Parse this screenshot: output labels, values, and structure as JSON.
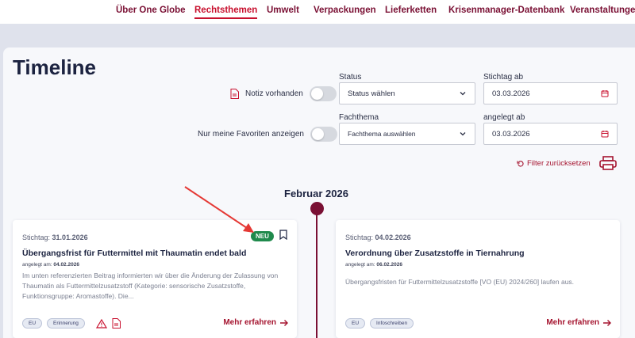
{
  "nav": {
    "items": [
      {
        "label": "Über One Globe"
      },
      {
        "label": "Rechtsthemen"
      },
      {
        "label": "Umwelt"
      },
      {
        "label": "Verpackungen"
      },
      {
        "label": "Lieferketten"
      },
      {
        "label": "Krisenmanager-Datenbank"
      },
      {
        "label": "Veranstaltungen"
      }
    ],
    "active": "Rechtsthemen"
  },
  "page": {
    "title": "Timeline"
  },
  "filters": {
    "notiz_label": "Notiz vorhanden",
    "favoriten_label": "Nur meine Favoriten anzeigen",
    "status_label": "Status",
    "status_value": "Status wählen",
    "fachthema_label": "Fachthema",
    "fachthema_value": "Fachthema auswählen",
    "stichtag_label": "Stichtag ab",
    "stichtag_value": "03.03.2026",
    "angelegt_label": "angelegt ab",
    "angelegt_value": "03.03.2026",
    "reset_label": "Filter zurücksetzen"
  },
  "timeline": {
    "month": "Februar 2026"
  },
  "cards": [
    {
      "stichtag_prefix": "Stichtag:",
      "stichtag_date": "31.01.2026",
      "title": "Übergangsfrist für Futtermittel mit Thaumatin endet bald",
      "angelegt_prefix": "angelegt am:",
      "angelegt_date": "04.02.2026",
      "desc_1": "Im unten referenzierten Beitrag informierten wir über die Änderung der Zulassung von",
      "desc_2": "Thaumatin als Futtermittelzusatzstoff (Kategorie: sensorische Zusatzstoffe,",
      "desc_3": "Funktionsgruppe: Aromastoffe). Die...",
      "badge": "NEU",
      "tags": [
        "EU",
        "Erinnerung"
      ],
      "more": "Mehr erfahren"
    },
    {
      "stichtag_prefix": "Stichtag:",
      "stichtag_date": "04.02.2026",
      "title": "Verordnung über Zusatzstoffe in Tiernahrung",
      "angelegt_prefix": "angelegt am:",
      "angelegt_date": "06.02.2026",
      "desc_1": "Übergangsfristen für Futtermittelzusatzstoffe [VO (EU) 2024/260] laufen aus.",
      "tags": [
        "EU",
        "Infoschreiben"
      ],
      "more": "Mehr erfahren"
    }
  ],
  "colors": {
    "accent": "#a5142f",
    "brand": "#7a1034",
    "neu": "#1f8a4c",
    "annotation": "#e53935"
  },
  "icons": [
    "document-icon",
    "calendar-icon",
    "chevron-down-icon",
    "reset-icon",
    "printer-icon",
    "bookmark-icon",
    "warning-icon",
    "arrow-right-icon"
  ]
}
